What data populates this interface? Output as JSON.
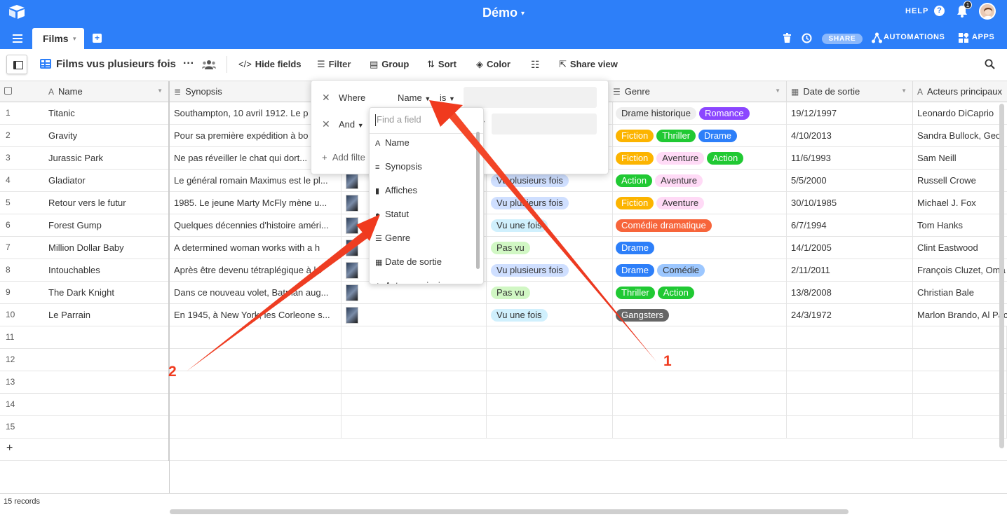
{
  "topbar": {
    "app_title": "Démo",
    "help": "HELP",
    "notifications_count": "1",
    "accent_color": "#2d7ff9"
  },
  "tabs": {
    "active": "Films"
  },
  "actions": {
    "share": "SHARE",
    "automations": "AUTOMATIONS",
    "apps": "APPS"
  },
  "toolbar": {
    "view_name": "Films vus plusieurs fois",
    "hide_fields": "Hide fields",
    "filter": "Filter",
    "group": "Group",
    "sort": "Sort",
    "color": "Color",
    "share_view": "Share view"
  },
  "columns": {
    "name": "Name",
    "synopsis": "Synopsis",
    "genre": "Genre",
    "date": "Date de sortie",
    "acteurs": "Acteurs principaux"
  },
  "rows": [
    {
      "n": "1",
      "name": "Titanic",
      "synopsis": "Southampton, 10 avril 1912. Le p",
      "statut": "",
      "genres": [
        [
          "Drame historique",
          "#eeeeee",
          "#333"
        ],
        [
          "Romance",
          "#8b46ff",
          "#fff"
        ]
      ],
      "date": "19/12/1997",
      "acteurs": "Leonardo DiCaprio"
    },
    {
      "n": "2",
      "name": "Gravity",
      "synopsis": "Pour sa première expédition à bo",
      "statut": "",
      "genres": [
        [
          "Fiction",
          "#fcb400",
          "#fff"
        ],
        [
          "Thriller",
          "#20c933",
          "#fff"
        ],
        [
          "Drame",
          "#2d7ff9",
          "#fff"
        ]
      ],
      "date": "4/10/2013",
      "acteurs": "Sandra Bullock, Geor"
    },
    {
      "n": "3",
      "name": "Jurassic Park",
      "synopsis": "Ne pas réveiller le chat qui dort...",
      "statut": "",
      "genres": [
        [
          "Fiction",
          "#fcb400",
          "#fff"
        ],
        [
          "Aventure",
          "#ffdaf6",
          "#333"
        ],
        [
          "Action",
          "#20c933",
          "#fff"
        ]
      ],
      "date": "11/6/1993",
      "acteurs": "Sam Neill"
    },
    {
      "n": "4",
      "name": "Gladiator",
      "synopsis": "Le général romain Maximus est le pl...",
      "statut": "Vu plusieurs fois",
      "sc": "#cfdfff",
      "genres": [
        [
          "Action",
          "#20c933",
          "#fff"
        ],
        [
          "Aventure",
          "#ffdaf6",
          "#333"
        ]
      ],
      "date": "5/5/2000",
      "acteurs": "Russell Crowe"
    },
    {
      "n": "5",
      "name": "Retour vers le futur",
      "synopsis": "1985. Le jeune Marty McFly mène u...",
      "statut": "Vu plusieurs fois",
      "sc": "#cfdfff",
      "genres": [
        [
          "Fiction",
          "#fcb400",
          "#fff"
        ],
        [
          "Aventure",
          "#ffdaf6",
          "#333"
        ]
      ],
      "date": "30/10/1985",
      "acteurs": "Michael J. Fox"
    },
    {
      "n": "6",
      "name": "Forest Gump",
      "synopsis": "Quelques décennies d'histoire améri...",
      "statut": "Vu une fois",
      "sc": "#d0f0fd",
      "genres": [
        [
          "Comédie dramatique",
          "#f7653b",
          "#fff"
        ]
      ],
      "date": "6/7/1994",
      "acteurs": "Tom Hanks"
    },
    {
      "n": "7",
      "name": "Million Dollar Baby",
      "synopsis": "A determined woman works with a h",
      "statut": "Pas vu",
      "sc": "#d1f7c4",
      "genres": [
        [
          "Drame",
          "#2d7ff9",
          "#fff"
        ]
      ],
      "date": "14/1/2005",
      "acteurs": "Clint Eastwood"
    },
    {
      "n": "8",
      "name": "Intouchables",
      "synopsis": "Après être devenu tétraplégique à la",
      "statut": "Vu plusieurs fois",
      "sc": "#cfdfff",
      "genres": [
        [
          "Drame",
          "#2d7ff9",
          "#fff"
        ],
        [
          "Comédie",
          "#9cc7ff",
          "#333"
        ]
      ],
      "date": "2/11/2011",
      "acteurs": "François Cluzet, Oma"
    },
    {
      "n": "9",
      "name": "The Dark Knight",
      "synopsis": "Dans ce nouveau volet, Batman aug...",
      "statut": "Pas vu",
      "sc": "#d1f7c4",
      "genres": [
        [
          "Thriller",
          "#20c933",
          "#fff"
        ],
        [
          "Action",
          "#20c933",
          "#fff"
        ]
      ],
      "date": "13/8/2008",
      "acteurs": "Christian Bale"
    },
    {
      "n": "10",
      "name": "Le Parrain",
      "synopsis": "En 1945, à New York, les Corleone s...",
      "statut": "Vu une fois",
      "sc": "#d0f0fd",
      "genres": [
        [
          "Gangsters",
          "#666666",
          "#fff"
        ]
      ],
      "date": "24/3/1972",
      "acteurs": "Marlon Brando, Al Pac"
    }
  ],
  "empty_rows": [
    "11",
    "12",
    "13",
    "14",
    "15"
  ],
  "footer": {
    "records": "15 records"
  },
  "filter": {
    "where": "Where",
    "field": "Name",
    "op": "is",
    "and": "And",
    "add": "Add filte"
  },
  "field_dropdown": {
    "placeholder": "Find a field",
    "options": [
      {
        "icon": "A",
        "label": "Name"
      },
      {
        "icon": "≡",
        "label": "Synopsis"
      },
      {
        "icon": "▮",
        "label": "Affiches"
      },
      {
        "icon": "●",
        "label": "Statut"
      },
      {
        "icon": "☰",
        "label": "Genre"
      },
      {
        "icon": "▦",
        "label": "Date de sortie"
      },
      {
        "icon": "A",
        "label": "Acteurs principaux"
      }
    ]
  },
  "annotations": {
    "a1": "1",
    "a2": "2",
    "color": "#f03a1e"
  }
}
